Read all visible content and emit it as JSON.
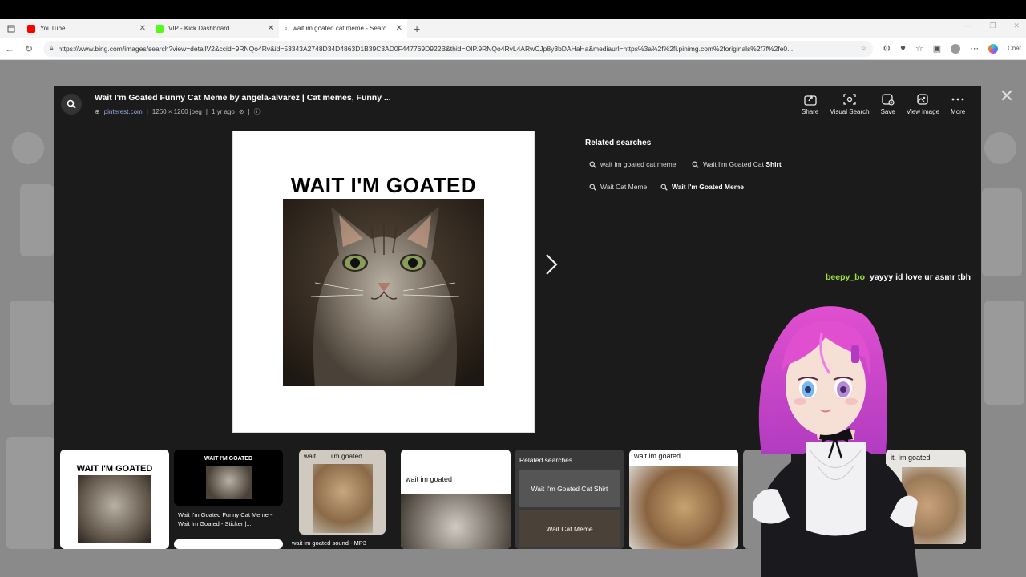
{
  "browser": {
    "tabs": [
      {
        "label": "YouTube",
        "favicon_color": "#ff0000",
        "active": false
      },
      {
        "label": "VIP - Kick Dashboard",
        "favicon_color": "#53fc18",
        "active": false
      },
      {
        "label": "wait im goated cat meme - Searc",
        "favicon_color": "#888888",
        "active": true
      }
    ],
    "new_tab": "+",
    "url": "https://www.bing.com/images/search?view=detailV2&ccid=9RNQo4Rv&id=53343A2748D34D4863D1B39C3AD0F447769D922B&thid=OIP.9RNQo4RvL4ARwCJp8y3bDAHaHa&mediaurl=https%3a%2f%2fi.pinimg.com%2foriginals%2f7f%2fe0...",
    "copilot_label": "Chat"
  },
  "viewer": {
    "title": "Wait I'm Goated Funny Cat Meme by angela-alvarez | Cat memes, Funny ...",
    "meta": {
      "site": "pinterest.com",
      "dims": "1260 × 1260 jpeg",
      "age": "1 yr ago"
    },
    "actions": [
      {
        "label": "Share",
        "icon": "share-icon"
      },
      {
        "label": "Visual Search",
        "icon": "visual-search-icon"
      },
      {
        "label": "Save",
        "icon": "save-icon"
      },
      {
        "label": "View image",
        "icon": "view-image-icon"
      },
      {
        "label": "More",
        "icon": "more-icon"
      }
    ],
    "meme_text": "WAIT I'M GOATED",
    "related": {
      "heading": "Related searches",
      "chips": [
        {
          "plain": "wait im goated cat meme",
          "bold": ""
        },
        {
          "plain": "Wait I'm Goated Cat ",
          "bold": "Shirt"
        },
        {
          "plain": "Wait Cat Meme",
          "bold": ""
        },
        {
          "plain": "",
          "bold": "Wait I'm Goated Meme"
        }
      ]
    }
  },
  "chat": {
    "user": "beepy_bo",
    "message": "yayyy id love ur asmr tbh"
  },
  "thumbnails": [
    {
      "caption": "WAIT I'M GOATED"
    },
    {
      "caption": "WAIT I'M GOATED",
      "sub": "Wait I'm Goated Funny Cat Meme - Wait Im Goated - Sticker |..."
    },
    {
      "caption": "wait....... i'm goated",
      "sub": "wait im goated sound - MP3"
    },
    {
      "caption": "wait im goated"
    },
    {
      "caption": "Related searches",
      "items": [
        "Wait I'm Goated Cat Shirt",
        "Wait Cat Meme"
      ]
    },
    {
      "caption": "wait im goated"
    },
    {
      "caption": "it. Im goated"
    }
  ]
}
